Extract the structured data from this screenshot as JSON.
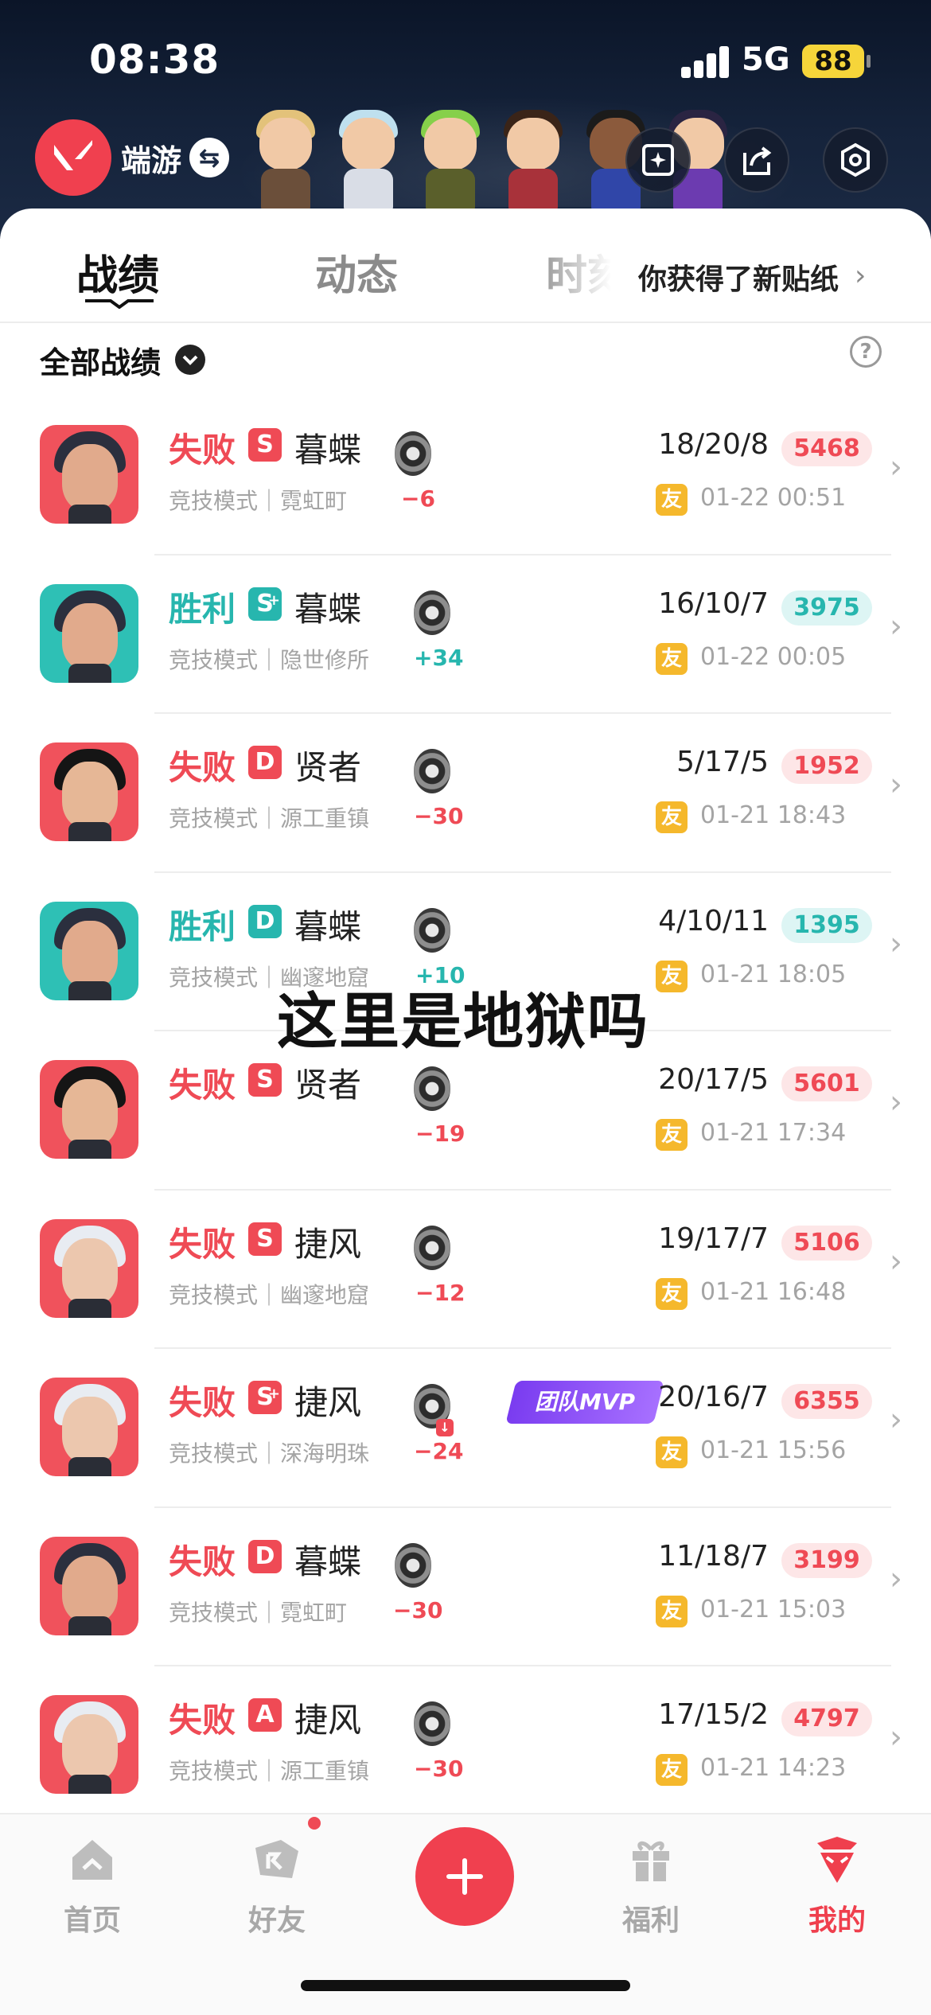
{
  "status": {
    "time": "08:38",
    "network": "5G",
    "battery": "88"
  },
  "header": {
    "brand": "端游",
    "switch_glyph": "⇆"
  },
  "tabs": {
    "items": [
      "战绩",
      "动态",
      "时刻"
    ],
    "sticker_text": "你获得了新贴纸",
    "sticker_chevron": "›"
  },
  "filter": {
    "label": "全部战绩",
    "help": "?"
  },
  "colors": {
    "accent": "#f0404f",
    "win": "#27b6ae",
    "lose": "#ef4a55",
    "friend_badge": "#f5b82c",
    "mvp": "#8a4cf5"
  },
  "matches": [
    {
      "result": "失败",
      "rank": "S",
      "hero": "暮蝶",
      "mode": "竞技模式｜霓虹町",
      "delta": "−6",
      "kda": "18/20/8",
      "score": "5468",
      "friend": "友",
      "time": "01-22 00:51",
      "mvp": ""
    },
    {
      "result": "胜利",
      "rank": "S",
      "rank_plus": "+",
      "hero": "暮蝶",
      "mode": "竞技模式｜隐世修所",
      "delta": "+34",
      "kda": "16/10/7",
      "score": "3975",
      "friend": "友",
      "time": "01-22 00:05",
      "mvp": ""
    },
    {
      "result": "失败",
      "rank": "D",
      "hero": "贤者",
      "mode": "竞技模式｜源工重镇",
      "delta": "−30",
      "kda": "5/17/5",
      "score": "1952",
      "friend": "友",
      "time": "01-21 18:43",
      "mvp": ""
    },
    {
      "result": "胜利",
      "rank": "D",
      "hero": "暮蝶",
      "mode": "竞技模式｜幽邃地窟",
      "delta": "+10",
      "kda": "4/10/11",
      "score": "1395",
      "friend": "友",
      "time": "01-21 18:05",
      "mvp": ""
    },
    {
      "result": "失败",
      "rank": "S",
      "hero": "贤者",
      "mode": "",
      "delta": "−19",
      "kda": "20/17/5",
      "score": "5601",
      "friend": "友",
      "time": "01-21 17:34",
      "mvp": ""
    },
    {
      "result": "失败",
      "rank": "S",
      "hero": "捷风",
      "mode": "竞技模式｜幽邃地窟",
      "delta": "−12",
      "kda": "19/17/7",
      "score": "5106",
      "friend": "友",
      "time": "01-21 16:48",
      "mvp": ""
    },
    {
      "result": "失败",
      "rank": "S",
      "rank_plus": "+",
      "hero": "捷风",
      "mode": "竞技模式｜深海明珠",
      "delta": "−24",
      "kda": "20/16/7",
      "score": "6355",
      "friend": "友",
      "time": "01-21 15:56",
      "mvp": "团队MVP"
    },
    {
      "result": "失败",
      "rank": "D",
      "hero": "暮蝶",
      "mode": "竞技模式｜霓虹町",
      "delta": "−30",
      "kda": "11/18/7",
      "score": "3199",
      "friend": "友",
      "time": "01-21 15:03",
      "mvp": ""
    },
    {
      "result": "失败",
      "rank": "A",
      "hero": "捷风",
      "mode": "竞技模式｜源工重镇",
      "delta": "−30",
      "kda": "17/15/2",
      "score": "4797",
      "friend": "友",
      "time": "01-21 14:23",
      "mvp": ""
    }
  ],
  "caption": "这里是地狱吗",
  "nav": {
    "home": "首页",
    "friends": "好友",
    "plus": "+",
    "welfare": "福利",
    "mine": "我的"
  }
}
